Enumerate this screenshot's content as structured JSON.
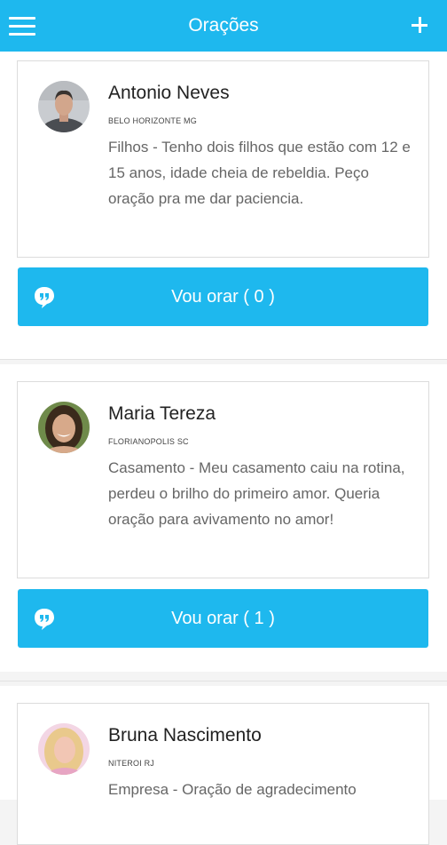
{
  "header": {
    "title": "Orações"
  },
  "posts": [
    {
      "name": "Antonio Neves",
      "city": "BELO HORIZONTE MG",
      "text": "Filhos - Tenho dois filhos que estão com 12 e 15 anos, idade cheia de rebeldia. Peço oração pra me dar paciencia.",
      "button_label": "Vou orar ( 0 )"
    },
    {
      "name": "Maria Tereza",
      "city": "FLORIANOPOLIS SC",
      "text": "Casamento - Meu casamento caiu na rotina, perdeu o brilho do primeiro amor. Queria oração para avivamento no amor!",
      "button_label": "Vou orar ( 1 )"
    },
    {
      "name": "Bruna Nascimento",
      "city": "NITEROI RJ",
      "text": "Empresa - Oração de agradecimento"
    }
  ],
  "colors": {
    "accent": "#1eb8ee",
    "background": "#f4f4f4"
  }
}
